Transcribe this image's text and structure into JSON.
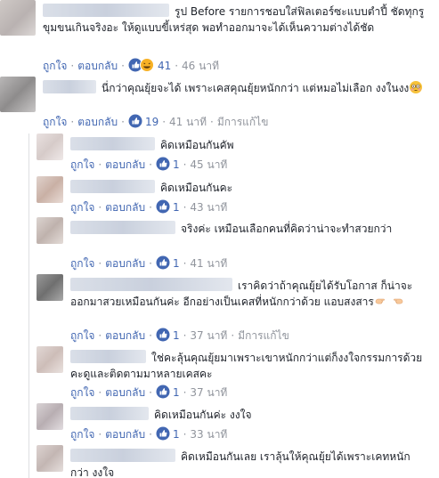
{
  "labels": {
    "like": "ถูกใจ",
    "reply": "ตอบกลับ",
    "dot": "·",
    "edited": "มีการแก้ไข"
  },
  "colors": {
    "link": "#4267b2",
    "meta": "#90949c",
    "text": "#1d2129",
    "like_blue": "#4267b2",
    "haha_yellow": "#f7b125"
  },
  "comments": [
    {
      "text": "รูป Before รายการชอบใส่ฟิลเตอร์ซะแบบตำปี้ ชัดทุกรูขุมขนเกินจริงอะ ให้ดูแบบขี้เหร่สุด พอทำออกมาจะได้เห็นความต่างได้ชัด",
      "reactions": [
        "like-icon",
        "haha-icon"
      ],
      "reaction_count": "41",
      "time": "46 นาที",
      "edited": false
    },
    {
      "text": "นี่กว่าคุณยุ้ยจะได้ เพราะเคสคุณยุ้ยหนักกว่า แต่หมอไม่เลือก งงในงง",
      "trailing_emoji": "flushed-face-icon",
      "reactions": [
        "like-icon"
      ],
      "reaction_count": "19",
      "time": "41 นาที",
      "edited": true
    }
  ],
  "replies": [
    {
      "text": "คิดเหมือนกันคัพ",
      "reaction_count": "1",
      "time": "45 นาที"
    },
    {
      "text": "คิดเหมือนกันคะ",
      "reaction_count": "1",
      "time": "43 นาที"
    },
    {
      "text": "จริงค่ะ เหมือนเลือกคนที่คิดว่าน่าจะทำสวยกว่า",
      "reaction_count": "1",
      "time": "41 นาที"
    },
    {
      "text": "เราคิดว่าถ้าคุณยุ้ยได้รับโอกาส ก็น่าจะออกมาสวยเหมือนกันค่ะ อีกอย่างเป็นเคสที่หนักกว่าด้วย แอบสงสาร",
      "trailing_emoji": "pointing-hands-icon",
      "reaction_count": "1",
      "time": "37 นาที",
      "edited": true
    },
    {
      "text": "ใช่คะลุ้นคุณยุ้ยมาเพราะเขาหนักกว่าแต่ก็งงใจกรรมการด้วยคะดูและติดตามมาหลายเคสคะ",
      "reaction_count": "1",
      "time": "37 นาที"
    },
    {
      "text": "คิดเหมือนกันค่ะ งงใจ",
      "reaction_count": "1",
      "time": "33 นาที"
    },
    {
      "text": "คิดเหมือนกันเลย เราลุ้นให้คุณยุ้ยได้เพราะเคทหนักกว่า งงใจ"
    }
  ]
}
